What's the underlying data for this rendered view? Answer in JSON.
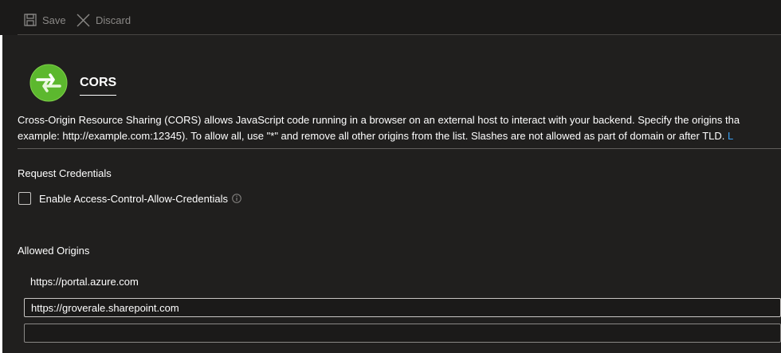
{
  "toolbar": {
    "save_label": "Save",
    "discard_label": "Discard",
    "save_icon": "save-icon",
    "discard_icon": "close-icon"
  },
  "header": {
    "title": "CORS",
    "logo_icon": "cors-refresh-logo-icon"
  },
  "description": {
    "line1": "Cross-Origin Resource Sharing (CORS) allows JavaScript code running in a browser on an external host to interact with your backend. Specify the origins tha",
    "line2_text": "example: http://example.com:12345). To allow all, use \"*\" and remove all other origins from the list. Slashes are not allowed as part of domain or after TLD. ",
    "line2_link": "L"
  },
  "credentials": {
    "section_title": "Request Credentials",
    "checkbox_label": "Enable Access-Control-Allow-Credentials",
    "checked": false,
    "info_icon": "info-icon"
  },
  "origins": {
    "section_title": "Allowed Origins",
    "static_origin": "https://portal.azure.com",
    "inputs": [
      {
        "value": "https://groverale.sharepoint.com",
        "placeholder": ""
      },
      {
        "value": "",
        "placeholder": ""
      }
    ]
  },
  "colors": {
    "background": "#1b1a19",
    "panel": "#201f1e",
    "text": "#ffffff",
    "muted": "#8a8886",
    "link": "#3aa0f3",
    "logo_green": "#5cb82e"
  }
}
